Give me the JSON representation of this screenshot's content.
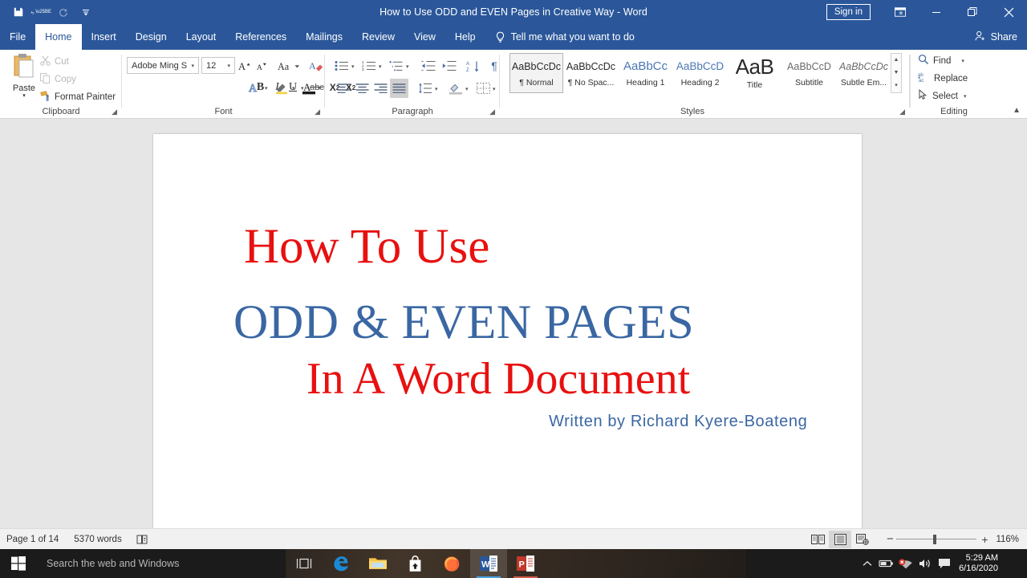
{
  "titlebar": {
    "document_title": "How to Use ODD and EVEN Pages in Creative Way  -  Word",
    "sign_in": "Sign in",
    "qat": [
      {
        "name": "save-icon",
        "label": "Save"
      },
      {
        "name": "undo-icon",
        "label": "Undo"
      },
      {
        "name": "redo-icon",
        "label": "Redo"
      },
      {
        "name": "customize-quick-access-toolbar-icon",
        "label": "Customize Quick Access Toolbar"
      }
    ],
    "window_controls": [
      {
        "name": "ribbon-display-options-icon",
        "glyph": "❐"
      },
      {
        "name": "minimize-icon",
        "glyph": "─"
      },
      {
        "name": "restore-icon",
        "glyph": "❐"
      },
      {
        "name": "close-icon",
        "glyph": "✕"
      }
    ]
  },
  "tabs": [
    {
      "label": "File",
      "active": false
    },
    {
      "label": "Home",
      "active": true
    },
    {
      "label": "Insert",
      "active": false
    },
    {
      "label": "Design",
      "active": false
    },
    {
      "label": "Layout",
      "active": false
    },
    {
      "label": "References",
      "active": false
    },
    {
      "label": "Mailings",
      "active": false
    },
    {
      "label": "Review",
      "active": false
    },
    {
      "label": "View",
      "active": false
    },
    {
      "label": "Help",
      "active": false
    }
  ],
  "tell_me": "Tell me what you want to do",
  "share": "Share",
  "ribbon": {
    "groups": [
      {
        "name": "Clipboard"
      },
      {
        "name": "Font"
      },
      {
        "name": "Paragraph"
      },
      {
        "name": "Styles"
      },
      {
        "name": "Editing"
      }
    ],
    "clipboard": {
      "paste": "Paste",
      "cut": "Cut",
      "copy": "Copy",
      "format_painter": "Format Painter"
    },
    "font": {
      "font_name": "Adobe Ming S",
      "font_size": "12",
      "buttons": [
        "grow-font",
        "shrink-font",
        "change-case",
        "clear-formatting",
        "bold",
        "italic",
        "underline",
        "strikethrough",
        "subscript",
        "superscript",
        "text-effects",
        "text-highlight-color",
        "font-color"
      ]
    },
    "paragraph": {
      "buttons": [
        "bullets",
        "numbering",
        "multilevel-list",
        "decrease-indent",
        "increase-indent",
        "sort",
        "show-formatting-marks",
        "align-left",
        "center",
        "align-right",
        "justify",
        "line-spacing",
        "shading",
        "borders"
      ],
      "active_alignment": "justify"
    },
    "styles": [
      {
        "sample": "AaBbCcDc",
        "name": "¶ Normal",
        "active": true,
        "color": "#2a2a2a",
        "size": "12.5px",
        "weight": "normal",
        "style": "normal"
      },
      {
        "sample": "AaBbCcDc",
        "name": "¶ No Spac...",
        "active": false,
        "color": "#2a2a2a",
        "size": "12.5px",
        "weight": "normal",
        "style": "normal"
      },
      {
        "sample": "AaBbCc",
        "name": "Heading 1",
        "active": false,
        "color": "#4a77b4",
        "size": "15px",
        "weight": "normal",
        "style": "normal"
      },
      {
        "sample": "AaBbCcD",
        "name": "Heading 2",
        "active": false,
        "color": "#4a77b4",
        "size": "13.5px",
        "weight": "normal",
        "style": "normal"
      },
      {
        "sample": "AaB",
        "name": "Title",
        "active": false,
        "color": "#2a2a2a",
        "size": "25px",
        "weight": "normal",
        "style": "normal"
      },
      {
        "sample": "AaBbCcD",
        "name": "Subtitle",
        "active": false,
        "color": "#6b6b6b",
        "size": "12.5px",
        "weight": "normal",
        "style": "normal"
      },
      {
        "sample": "AaBbCcDc",
        "name": "Subtle Em...",
        "active": false,
        "color": "#6b6b6b",
        "size": "12.5px",
        "weight": "normal",
        "style": "italic"
      }
    ],
    "editing": {
      "find": "Find",
      "replace": "Replace",
      "select": "Select"
    },
    "collapse_tooltip": "Collapse the Ribbon"
  },
  "document": {
    "lines": [
      {
        "text": "How To Use",
        "color": "#e81010"
      },
      {
        "text": "ODD & EVEN PAGES",
        "color": "#3a67a3"
      },
      {
        "text": "In A Word Document",
        "color": "#e81010"
      },
      {
        "text": "Written  by Richard  Kyere-Boateng",
        "color": "#3a67a3"
      }
    ]
  },
  "statusbar": {
    "page": "Page 1 of 14",
    "words": "5370 words",
    "proofing_icon": "proofing-errors-icon",
    "views": [
      {
        "name": "read-mode-view-button",
        "selected": false
      },
      {
        "name": "print-layout-view-button",
        "selected": true
      },
      {
        "name": "web-layout-view-button",
        "selected": false
      }
    ],
    "zoom_out": "−",
    "zoom_in": "+",
    "zoom_level": "116%"
  },
  "taskbar": {
    "search_placeholder": "Search the web and Windows",
    "start_button": "start-button",
    "items": [
      {
        "name": "task-view-button",
        "active": false
      },
      {
        "name": "microsoft-edge-taskbar-icon",
        "active": false,
        "pinned": true
      },
      {
        "name": "file-explorer-taskbar-icon",
        "active": false,
        "pinned": true
      },
      {
        "name": "microsoft-store-taskbar-icon",
        "active": false,
        "pinned": false
      },
      {
        "name": "firefox-taskbar-icon",
        "active": false,
        "pinned": false
      },
      {
        "name": "microsoft-word-taskbar-icon",
        "active": true,
        "pinned": true
      },
      {
        "name": "microsoft-powerpoint-taskbar-icon",
        "active": false,
        "pinned": true
      }
    ],
    "tray": [
      {
        "name": "show-hidden-icons-chevron-up-icon"
      },
      {
        "name": "battery-icon"
      },
      {
        "name": "network-disconnected-icon"
      },
      {
        "name": "volume-icon"
      },
      {
        "name": "action-center-icon"
      }
    ],
    "clock_time": "5:29 AM",
    "clock_date": "6/16/2020"
  },
  "colors": {
    "word_blue": "#2b579a",
    "title_red": "#e81010",
    "title_blue": "#3a67a3",
    "taskbar": "#1b1b1b"
  }
}
